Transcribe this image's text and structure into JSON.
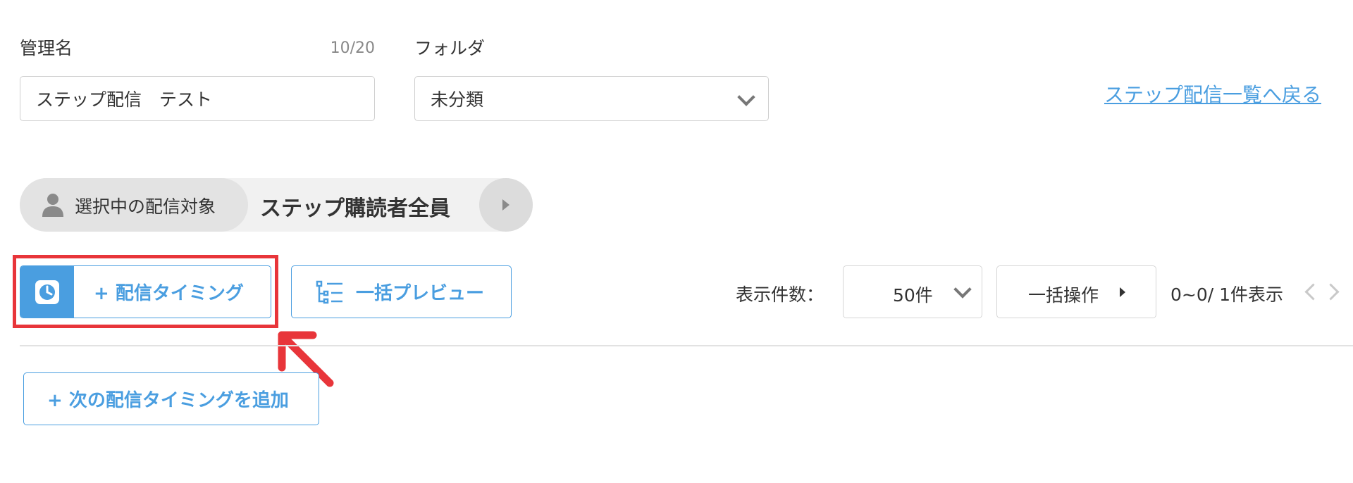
{
  "form": {
    "name_label": "管理名",
    "name_count": "10/20",
    "name_value": "ステップ配信　テスト",
    "folder_label": "フォルダ",
    "folder_value": "未分類"
  },
  "back_link": "ステップ配信一覧へ戻る",
  "target": {
    "label": "選択中の配信対象",
    "value": "ステップ購読者全員"
  },
  "toolbar": {
    "timing_button": "+ 配信タイミング",
    "preview_button": "一括プレビュー",
    "display_count_label": "表示件数：",
    "display_count_value": "50件",
    "bulk_action": "一括操作",
    "range_text": "0~0/ 1件表示"
  },
  "add_timing_button": "+ 次の配信タイミングを追加",
  "colors": {
    "accent": "#4a9ee0",
    "highlight": "#e8353a"
  }
}
